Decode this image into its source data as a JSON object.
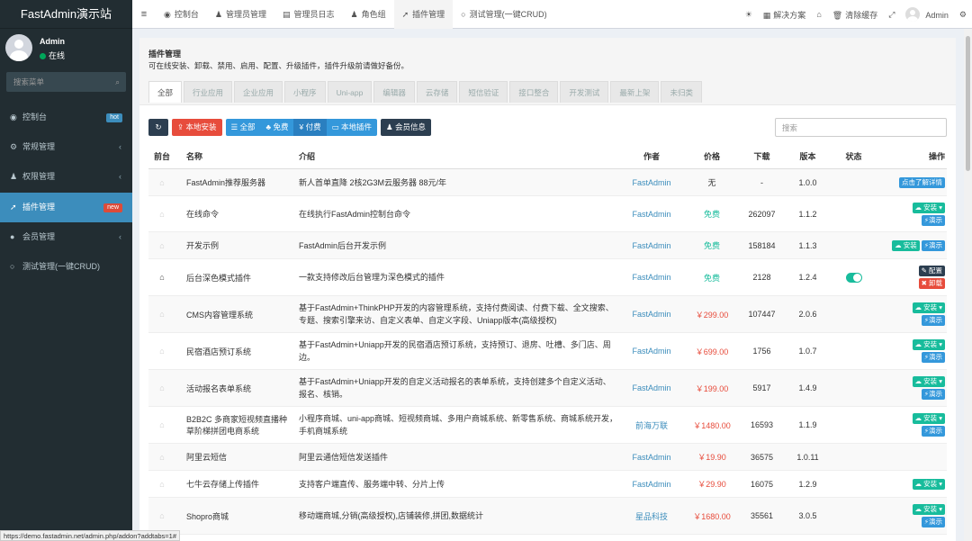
{
  "brand": "FastAdmin演示站",
  "user": {
    "name": "Admin",
    "status": "在线"
  },
  "side_search": {
    "placeholder": "搜索菜单"
  },
  "menu": [
    {
      "icon": "dashboard-icon",
      "glyph": "◉",
      "label": "控制台",
      "badge": "hot"
    },
    {
      "icon": "cogs-icon",
      "glyph": "⚙",
      "label": "常规管理",
      "chevron": "‹"
    },
    {
      "icon": "group-icon",
      "glyph": "♟",
      "label": "权限管理",
      "chevron": "‹"
    },
    {
      "icon": "rocket-icon",
      "glyph": "➚",
      "label": "插件管理",
      "badge": "new"
    },
    {
      "icon": "user-circle-icon",
      "glyph": "●",
      "label": "会员管理",
      "chevron": "‹"
    },
    {
      "icon": "circle-icon",
      "glyph": "○",
      "label": "测试管理(一键CRUD)"
    }
  ],
  "topbar": {
    "toggle": "≡",
    "tabs": [
      {
        "label": "控制台",
        "icon": "dashboard-icon",
        "glyph": "◉"
      },
      {
        "label": "管理员管理",
        "icon": "user-icon",
        "glyph": "♟"
      },
      {
        "label": "管理员日志",
        "icon": "list-icon",
        "glyph": "▤"
      },
      {
        "label": "角色组",
        "icon": "group-icon",
        "glyph": "♟"
      },
      {
        "label": "插件管理",
        "icon": "rocket-icon",
        "glyph": "➚"
      },
      {
        "label": "测试管理(一键CRUD)",
        "icon": "circle-icon",
        "glyph": "○"
      }
    ],
    "right": {
      "theme_glyph": "☀",
      "solution": "解决方案",
      "solution_glyph": "▦",
      "home_glyph": "⌂",
      "clear_cache": "清除缓存",
      "trash_glyph": "🗑",
      "fullscreen_glyph": "⤢",
      "user": "Admin",
      "settings_glyph": "⚙"
    }
  },
  "page": {
    "title": "插件管理",
    "description": "可在线安装、卸载、禁用、启用、配置、升级插件，插件升级前请做好备份。",
    "categories": [
      "全部",
      "行业应用",
      "企业应用",
      "小程序",
      "Uni-app",
      "编辑器",
      "云存储",
      "短信验证",
      "接口整合",
      "开发测试",
      "最新上架",
      "未归类"
    ]
  },
  "toolbar": {
    "refresh": "↻",
    "local_install": "本地安装",
    "filter": [
      "全部",
      "免费",
      "付费",
      "本地插件"
    ],
    "member": "会员信息",
    "search_placeholder": "搜索"
  },
  "table": {
    "headers": [
      "前台",
      "名称",
      "介绍",
      "作者",
      "价格",
      "下载",
      "版本",
      "状态",
      "操作"
    ],
    "rows": [
      {
        "name": "FastAdmin推荐服务器",
        "intro": "新人首单直降 2核2G3M云服务器 88元/年",
        "author": "FastAdmin",
        "price": "无",
        "price_type": "none",
        "downloads": "-",
        "version": "1.0.0",
        "ops": "detail"
      },
      {
        "name": "在线命令",
        "intro": "在线执行FastAdmin控制台命令",
        "author": "FastAdmin",
        "price": "免费",
        "price_type": "free",
        "downloads": "262097",
        "version": "1.1.2",
        "ops": "install-stack"
      },
      {
        "name": "开发示例",
        "intro": "FastAdmin后台开发示例",
        "author": "FastAdmin",
        "price": "免费",
        "price_type": "free",
        "downloads": "158184",
        "version": "1.1.3",
        "ops": "install-inline"
      },
      {
        "name": "后台深色模式插件",
        "intro": "一款支持修改后台管理为深色模式的插件",
        "author": "FastAdmin",
        "price": "免费",
        "price_type": "free",
        "downloads": "2128",
        "version": "1.2.4",
        "ops": "config",
        "home_on": true,
        "status": "on"
      },
      {
        "name": "CMS内容管理系统",
        "intro": "基于FastAdmin+ThinkPHP开发的内容管理系统，支持付费阅读、付费下载、全文搜索、专题、搜索引擎来访、自定义表单、自定义字段、Uniapp版本(高级授权)",
        "author": "FastAdmin",
        "price": "￥299.00",
        "price_type": "paid",
        "downloads": "107447",
        "version": "2.0.6",
        "ops": "install-stack"
      },
      {
        "name": "民宿酒店预订系统",
        "intro": "基于FastAdmin+Uniapp开发的民宿酒店预订系统，支持预订、退房、吐槽、多门店、周边。",
        "author": "FastAdmin",
        "price": "￥699.00",
        "price_type": "paid",
        "downloads": "1756",
        "version": "1.0.7",
        "ops": "install-stack"
      },
      {
        "name": "活动报名表单系统",
        "intro": "基于FastAdmin+Uniapp开发的自定义活动报名的表单系统，支持创建多个自定义活动、报名、核销。",
        "author": "FastAdmin",
        "price": "￥199.00",
        "price_type": "paid",
        "downloads": "5917",
        "version": "1.4.9",
        "ops": "install-stack"
      },
      {
        "name": "B2B2C 多商家短视频直播种草阶梯拼团电商系统",
        "intro": "小程序商城、uni-app商城、短视频商城、多用户商城系统、新零售系统、商城系统开发，手机商城系统",
        "author": "前海万联",
        "price": "￥1480.00",
        "price_type": "paid",
        "downloads": "16593",
        "version": "1.1.9",
        "ops": "install-stack"
      },
      {
        "name": "阿里云短信",
        "intro": "阿里云通信短信发送插件",
        "author": "FastAdmin",
        "price": "￥19.90",
        "price_type": "paid",
        "downloads": "36575",
        "version": "1.0.11",
        "ops": "none"
      },
      {
        "name": "七牛云存储上传插件",
        "intro": "支持客户端直传、服务端中转、分片上传",
        "author": "FastAdmin",
        "price": "￥29.90",
        "price_type": "paid",
        "downloads": "16075",
        "version": "1.2.9",
        "ops": "install-single"
      },
      {
        "name": "Shopro商城",
        "intro": "移动端商城,分销(高级授权),店铺装修,拼团,数据统计",
        "author": "星品科技",
        "price": "￥1680.00",
        "price_type": "paid",
        "downloads": "35561",
        "version": "3.0.5",
        "ops": "install-stack"
      }
    ],
    "op_labels": {
      "detail": "点击了解详情",
      "install": "安装",
      "demo": "演示",
      "config": "配置",
      "uninstall": "卸载"
    }
  },
  "statusbar": "https://demo.fastadmin.net/admin.php/addon?addtabs=1#"
}
